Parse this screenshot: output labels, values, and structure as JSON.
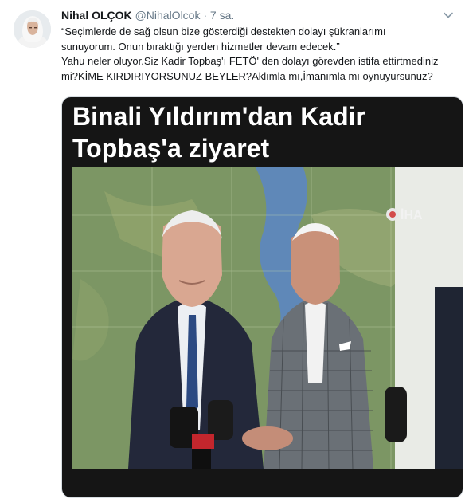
{
  "tweet": {
    "author_name": "Nihal OLÇOK",
    "handle": "@NihalOlcok",
    "separator": "·",
    "time": "7 sa.",
    "text_line1": "“Seçimlerde de sağ olsun bize gösterdiği destekten dolayı şükranlarımı",
    "text_line2": "sunuyorum. Onun bıraktığı yerden hizmetler devam edecek.”",
    "text_line3": "Yahu neler oluyor.Siz Kadir Topbaş'ı FETÖ' den dolayı görevden istifa ettirtmediniz",
    "text_line4": "mi?KİME KIRDIRIYORSUNUZ BEYLER?Aklımla mı,İmanımla mı oynuyursunuz?",
    "media": {
      "title_line1": "Binali Yıldırım'dan Kadir",
      "title_line2": "Topbaş'a ziyaret",
      "watermark": "İHA"
    },
    "icons": {
      "avatar": "profile-photo",
      "caret": "chevron-down-icon"
    }
  }
}
